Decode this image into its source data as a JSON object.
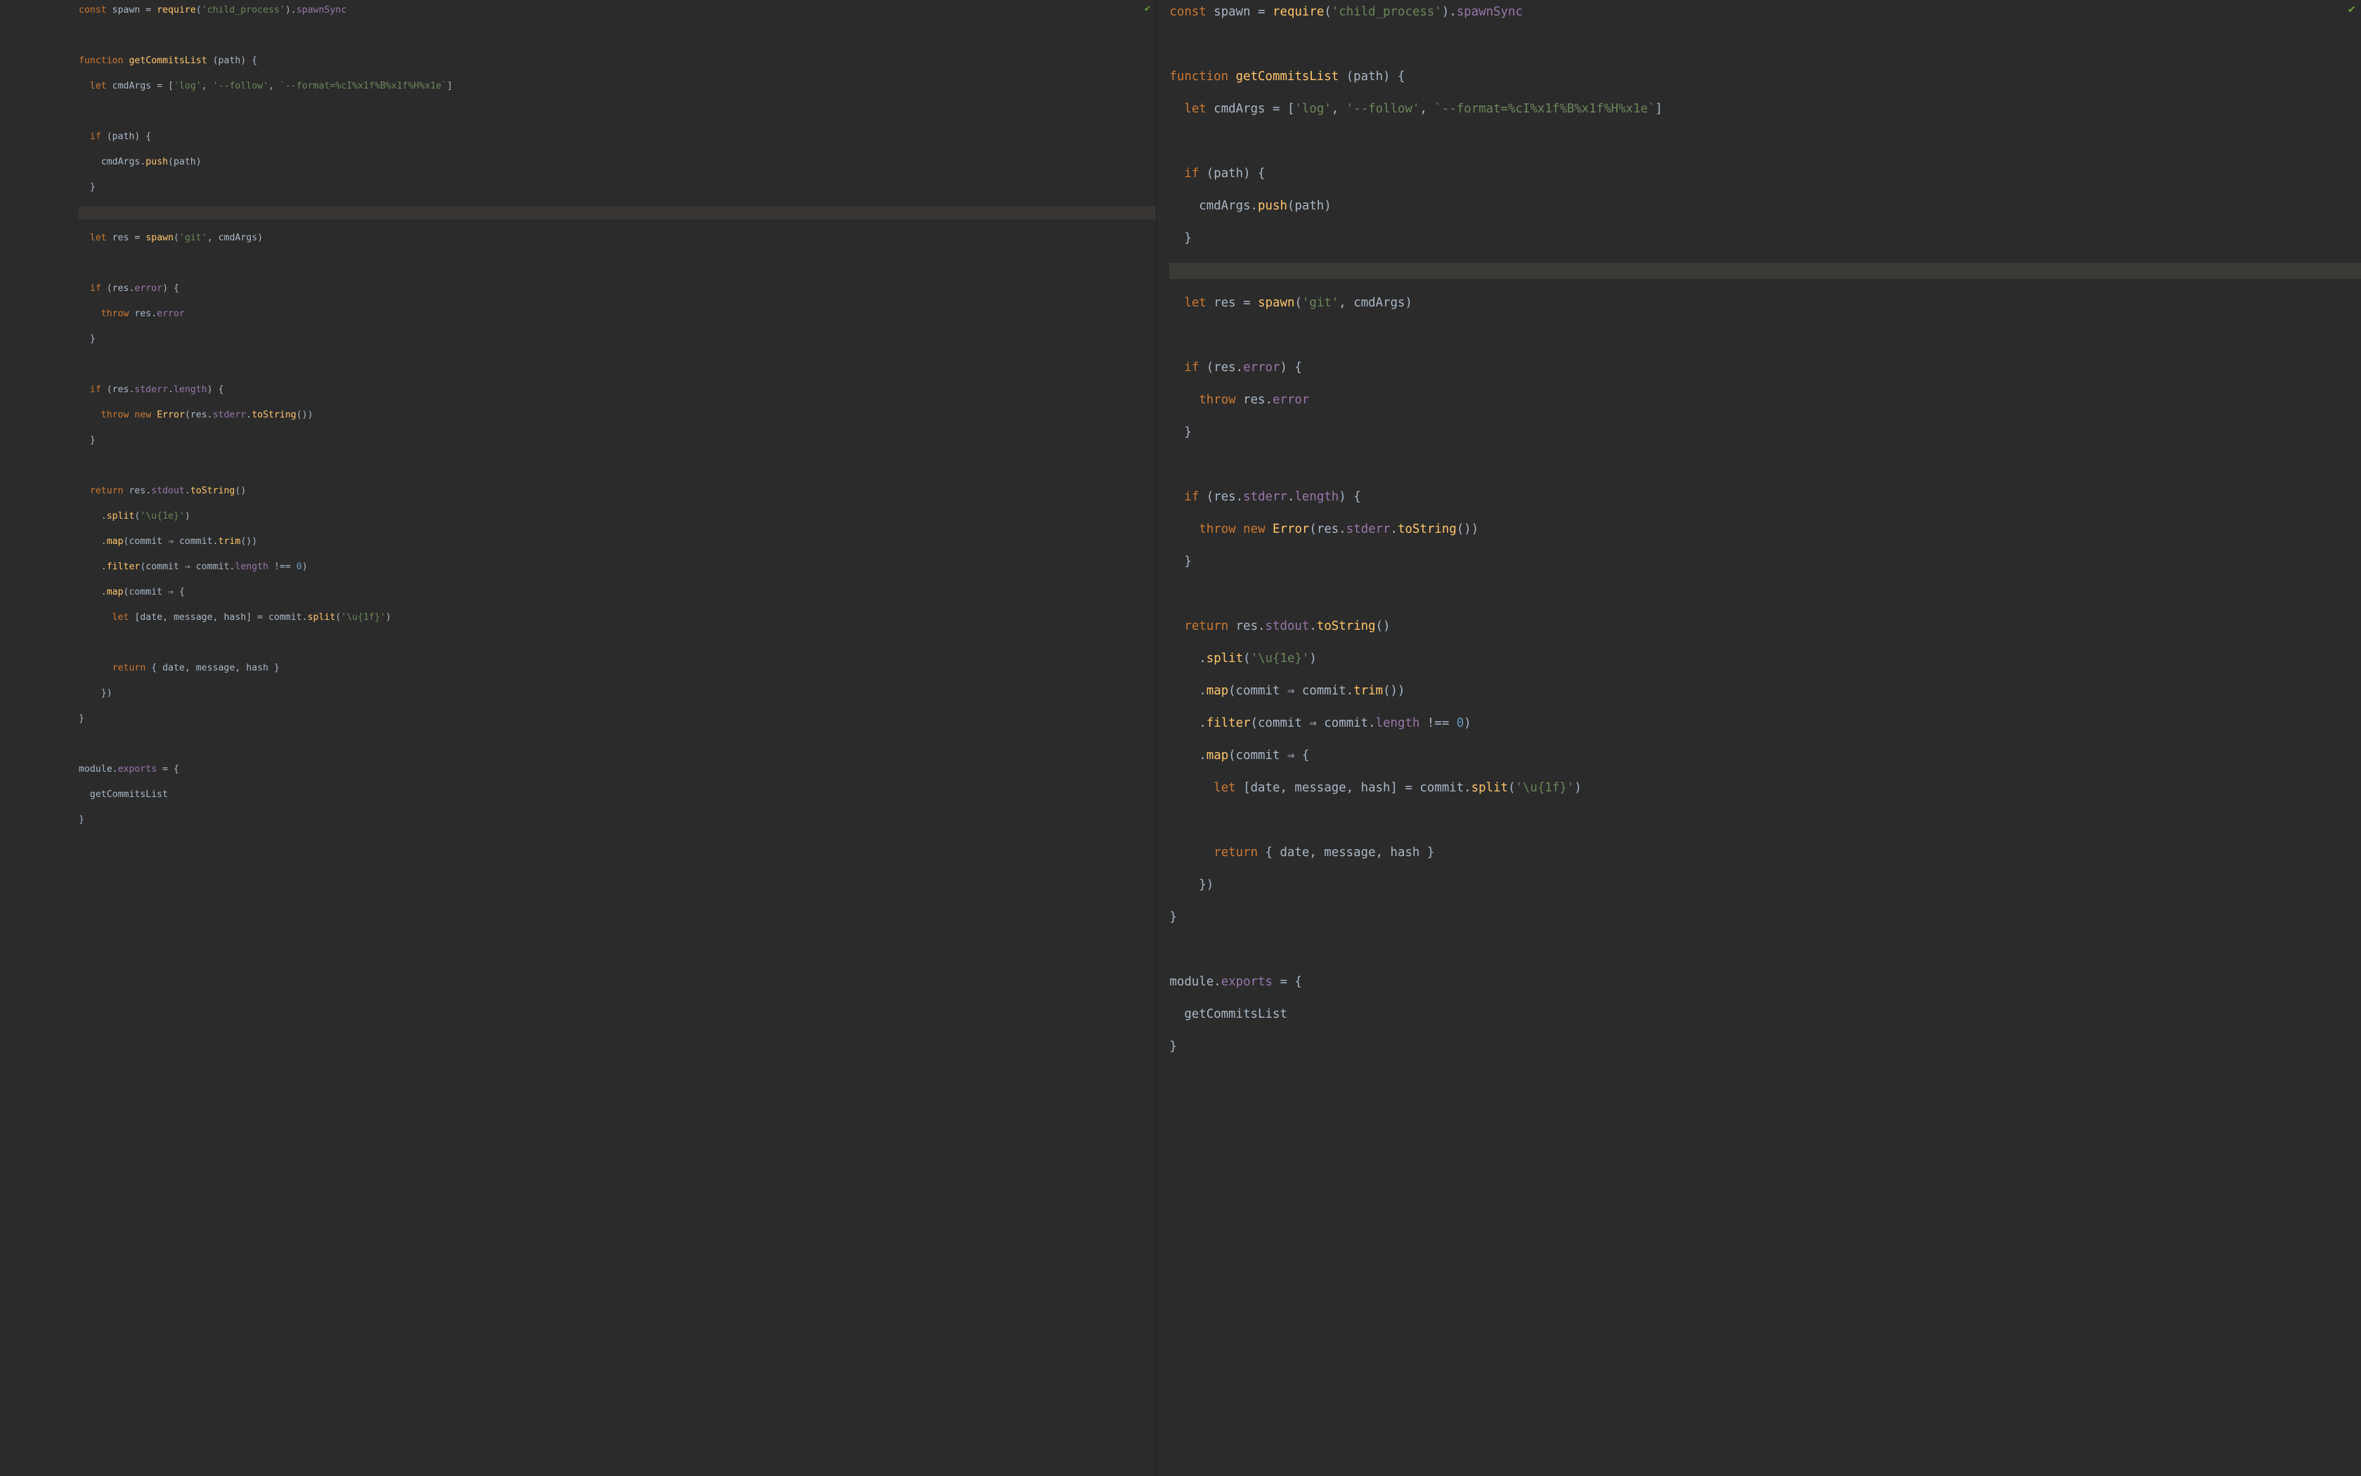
{
  "icons": {
    "check": "✔"
  },
  "left": {
    "font_px": 13.2,
    "highlight_lines_del": [
      9
    ],
    "code_tokens": [
      [
        [
          "kw",
          "const"
        ],
        [
          "pl",
          " spawn "
        ],
        [
          "op",
          "="
        ],
        [
          "pl",
          " "
        ],
        [
          "fn",
          "require"
        ],
        [
          "pl",
          "("
        ],
        [
          "str",
          "'child_process'"
        ],
        [
          "pl",
          ")."
        ],
        [
          "prop",
          "spawnSync"
        ]
      ],
      [],
      [
        [
          "kw",
          "function"
        ],
        [
          "pl",
          " "
        ],
        [
          "fn",
          "getCommitsList"
        ],
        [
          "pl",
          " (path) {"
        ]
      ],
      [
        [
          "pl",
          "  "
        ],
        [
          "kw",
          "let"
        ],
        [
          "pl",
          " cmdArgs "
        ],
        [
          "op",
          "="
        ],
        [
          "pl",
          " ["
        ],
        [
          "str",
          "'log'"
        ],
        [
          "pl",
          ", "
        ],
        [
          "str",
          "'--follow'"
        ],
        [
          "pl",
          ", "
        ],
        [
          "str",
          "`--format=%cI%x1f%B%x1f%H%x1e`"
        ],
        [
          "pl",
          "]"
        ]
      ],
      [],
      [
        [
          "pl",
          "  "
        ],
        [
          "kw",
          "if"
        ],
        [
          "pl",
          " (path) {"
        ]
      ],
      [
        [
          "pl",
          "    cmdArgs."
        ],
        [
          "fn",
          "push"
        ],
        [
          "pl",
          "(path)"
        ]
      ],
      [
        [
          "pl",
          "  }"
        ]
      ],
      [],
      [
        [
          "pl",
          "  "
        ],
        [
          "kw",
          "let"
        ],
        [
          "pl",
          " res "
        ],
        [
          "op",
          "="
        ],
        [
          "pl",
          " "
        ],
        [
          "fn",
          "spawn"
        ],
        [
          "pl",
          "("
        ],
        [
          "str",
          "'git'"
        ],
        [
          "pl",
          ", cmdArgs)"
        ]
      ],
      [],
      [
        [
          "pl",
          "  "
        ],
        [
          "kw",
          "if"
        ],
        [
          "pl",
          " (res."
        ],
        [
          "prop",
          "error"
        ],
        [
          "pl",
          ") {"
        ]
      ],
      [
        [
          "pl",
          "    "
        ],
        [
          "kw",
          "throw"
        ],
        [
          "pl",
          " res."
        ],
        [
          "prop",
          "error"
        ]
      ],
      [
        [
          "pl",
          "  }"
        ]
      ],
      [],
      [
        [
          "pl",
          "  "
        ],
        [
          "kw",
          "if"
        ],
        [
          "pl",
          " (res."
        ],
        [
          "prop",
          "stderr"
        ],
        [
          "pl",
          "."
        ],
        [
          "prop",
          "length"
        ],
        [
          "pl",
          ") {"
        ]
      ],
      [
        [
          "pl",
          "    "
        ],
        [
          "kw",
          "throw"
        ],
        [
          "pl",
          " "
        ],
        [
          "kw",
          "new"
        ],
        [
          "pl",
          " "
        ],
        [
          "fn",
          "Error"
        ],
        [
          "pl",
          "(res."
        ],
        [
          "prop",
          "stderr"
        ],
        [
          "pl",
          "."
        ],
        [
          "fn",
          "toString"
        ],
        [
          "pl",
          "())"
        ]
      ],
      [
        [
          "pl",
          "  }"
        ]
      ],
      [],
      [
        [
          "pl",
          "  "
        ],
        [
          "kw",
          "return"
        ],
        [
          "pl",
          " res."
        ],
        [
          "prop",
          "stdout"
        ],
        [
          "pl",
          "."
        ],
        [
          "fn",
          "toString"
        ],
        [
          "pl",
          "()"
        ]
      ],
      [
        [
          "pl",
          "    ."
        ],
        [
          "fn",
          "split"
        ],
        [
          "pl",
          "("
        ],
        [
          "str",
          "'\\u{1e}'"
        ],
        [
          "pl",
          ")"
        ]
      ],
      [
        [
          "pl",
          "    ."
        ],
        [
          "fn",
          "map"
        ],
        [
          "pl",
          "(commit "
        ],
        [
          "op",
          "⇒"
        ],
        [
          "pl",
          " commit."
        ],
        [
          "fn",
          "trim"
        ],
        [
          "pl",
          "())"
        ]
      ],
      [
        [
          "pl",
          "    ."
        ],
        [
          "fn",
          "filter"
        ],
        [
          "pl",
          "(commit "
        ],
        [
          "op",
          "⇒"
        ],
        [
          "pl",
          " commit."
        ],
        [
          "prop",
          "length"
        ],
        [
          "pl",
          " "
        ],
        [
          "op",
          "!=="
        ],
        [
          "pl",
          " "
        ],
        [
          "num",
          "0"
        ],
        [
          "pl",
          ")"
        ]
      ],
      [
        [
          "pl",
          "    ."
        ],
        [
          "fn",
          "map"
        ],
        [
          "pl",
          "(commit "
        ],
        [
          "op",
          "⇒"
        ],
        [
          "pl",
          " {"
        ]
      ],
      [
        [
          "pl",
          "      "
        ],
        [
          "kw",
          "let"
        ],
        [
          "pl",
          " [date, message, hash] "
        ],
        [
          "op",
          "="
        ],
        [
          "pl",
          " commit."
        ],
        [
          "fn",
          "split"
        ],
        [
          "pl",
          "("
        ],
        [
          "str",
          "'\\u{1f}'"
        ],
        [
          "pl",
          ")"
        ]
      ],
      [],
      [
        [
          "pl",
          "      "
        ],
        [
          "kw",
          "return"
        ],
        [
          "pl",
          " { date, message, hash }"
        ]
      ],
      [
        [
          "pl",
          "    })"
        ]
      ],
      [
        [
          "pl",
          "}"
        ]
      ],
      [],
      [
        [
          "pl",
          "module."
        ],
        [
          "prop",
          "exports"
        ],
        [
          "pl",
          " "
        ],
        [
          "op",
          "="
        ],
        [
          "pl",
          " {"
        ]
      ],
      [
        [
          "pl",
          "  getCommitsList"
        ]
      ],
      [
        [
          "pl",
          "}"
        ]
      ]
    ]
  },
  "right": {
    "font_px": 17.4,
    "highlight_lines_add": [
      9
    ],
    "code_tokens": [
      [
        [
          "kw",
          "const"
        ],
        [
          "pl",
          " spawn "
        ],
        [
          "op",
          "="
        ],
        [
          "pl",
          " "
        ],
        [
          "fn",
          "require"
        ],
        [
          "pl",
          "("
        ],
        [
          "str",
          "'child_process'"
        ],
        [
          "pl",
          ")."
        ],
        [
          "prop",
          "spawnSync"
        ]
      ],
      [],
      [
        [
          "kw",
          "function"
        ],
        [
          "pl",
          " "
        ],
        [
          "fn",
          "getCommitsList"
        ],
        [
          "pl",
          " (path) {"
        ]
      ],
      [
        [
          "pl",
          "  "
        ],
        [
          "kw",
          "let"
        ],
        [
          "pl",
          " cmdArgs "
        ],
        [
          "op",
          "="
        ],
        [
          "pl",
          " ["
        ],
        [
          "str",
          "'log'"
        ],
        [
          "pl",
          ", "
        ],
        [
          "str",
          "'--follow'"
        ],
        [
          "pl",
          ", "
        ],
        [
          "str",
          "`--format=%cI%x1f%B%x1f%H%x1e`"
        ],
        [
          "pl",
          "]"
        ]
      ],
      [],
      [
        [
          "pl",
          "  "
        ],
        [
          "kw",
          "if"
        ],
        [
          "pl",
          " (path) {"
        ]
      ],
      [
        [
          "pl",
          "    cmdArgs."
        ],
        [
          "fn",
          "push"
        ],
        [
          "pl",
          "(path)"
        ]
      ],
      [
        [
          "pl",
          "  }"
        ]
      ],
      [],
      [
        [
          "pl",
          "  "
        ],
        [
          "kw",
          "let"
        ],
        [
          "pl",
          " res "
        ],
        [
          "op",
          "="
        ],
        [
          "pl",
          " "
        ],
        [
          "fn",
          "spawn"
        ],
        [
          "pl",
          "("
        ],
        [
          "str",
          "'git'"
        ],
        [
          "pl",
          ", cmdArgs)"
        ]
      ],
      [],
      [
        [
          "pl",
          "  "
        ],
        [
          "kw",
          "if"
        ],
        [
          "pl",
          " (res."
        ],
        [
          "prop",
          "error"
        ],
        [
          "pl",
          ") {"
        ]
      ],
      [
        [
          "pl",
          "    "
        ],
        [
          "kw",
          "throw"
        ],
        [
          "pl",
          " res."
        ],
        [
          "prop",
          "error"
        ]
      ],
      [
        [
          "pl",
          "  }"
        ]
      ],
      [],
      [
        [
          "pl",
          "  "
        ],
        [
          "kw",
          "if"
        ],
        [
          "pl",
          " (res."
        ],
        [
          "prop",
          "stderr"
        ],
        [
          "pl",
          "."
        ],
        [
          "prop",
          "length"
        ],
        [
          "pl",
          ") {"
        ]
      ],
      [
        [
          "pl",
          "    "
        ],
        [
          "kw",
          "throw"
        ],
        [
          "pl",
          " "
        ],
        [
          "kw",
          "new"
        ],
        [
          "pl",
          " "
        ],
        [
          "fn",
          "Error"
        ],
        [
          "pl",
          "(res."
        ],
        [
          "prop",
          "stderr"
        ],
        [
          "pl",
          "."
        ],
        [
          "fn",
          "toString"
        ],
        [
          "pl",
          "())"
        ]
      ],
      [
        [
          "pl",
          "  }"
        ]
      ],
      [],
      [
        [
          "pl",
          "  "
        ],
        [
          "kw",
          "return"
        ],
        [
          "pl",
          " res."
        ],
        [
          "prop",
          "stdout"
        ],
        [
          "pl",
          "."
        ],
        [
          "fn",
          "toString"
        ],
        [
          "pl",
          "()"
        ]
      ],
      [
        [
          "pl",
          "    ."
        ],
        [
          "fn",
          "split"
        ],
        [
          "pl",
          "("
        ],
        [
          "str",
          "'\\u{1e}'"
        ],
        [
          "pl",
          ")"
        ]
      ],
      [
        [
          "pl",
          "    ."
        ],
        [
          "fn",
          "map"
        ],
        [
          "pl",
          "(commit "
        ],
        [
          "op",
          "⇒"
        ],
        [
          "pl",
          " commit."
        ],
        [
          "fn",
          "trim"
        ],
        [
          "pl",
          "())"
        ]
      ],
      [
        [
          "pl",
          "    ."
        ],
        [
          "fn",
          "filter"
        ],
        [
          "pl",
          "(commit "
        ],
        [
          "op",
          "⇒"
        ],
        [
          "pl",
          " commit."
        ],
        [
          "prop",
          "length"
        ],
        [
          "pl",
          " "
        ],
        [
          "op",
          "!=="
        ],
        [
          "pl",
          " "
        ],
        [
          "num",
          "0"
        ],
        [
          "pl",
          ")"
        ]
      ],
      [
        [
          "pl",
          "    ."
        ],
        [
          "fn",
          "map"
        ],
        [
          "pl",
          "(commit "
        ],
        [
          "op",
          "⇒"
        ],
        [
          "pl",
          " {"
        ]
      ],
      [
        [
          "pl",
          "      "
        ],
        [
          "kw",
          "let"
        ],
        [
          "pl",
          " [date, message, hash] "
        ],
        [
          "op",
          "="
        ],
        [
          "pl",
          " commit."
        ],
        [
          "fn",
          "split"
        ],
        [
          "pl",
          "("
        ],
        [
          "str",
          "'\\u{1f}'"
        ],
        [
          "pl",
          ")"
        ]
      ],
      [],
      [
        [
          "pl",
          "      "
        ],
        [
          "kw",
          "return"
        ],
        [
          "pl",
          " { date, message, hash }"
        ]
      ],
      [
        [
          "pl",
          "    })"
        ]
      ],
      [
        [
          "pl",
          "}"
        ]
      ],
      [],
      [
        [
          "pl",
          "module."
        ],
        [
          "prop",
          "exports"
        ],
        [
          "pl",
          " "
        ],
        [
          "op",
          "="
        ],
        [
          "pl",
          " {"
        ]
      ],
      [
        [
          "pl",
          "  getCommitsList"
        ]
      ],
      [
        [
          "pl",
          "}"
        ]
      ]
    ]
  }
}
